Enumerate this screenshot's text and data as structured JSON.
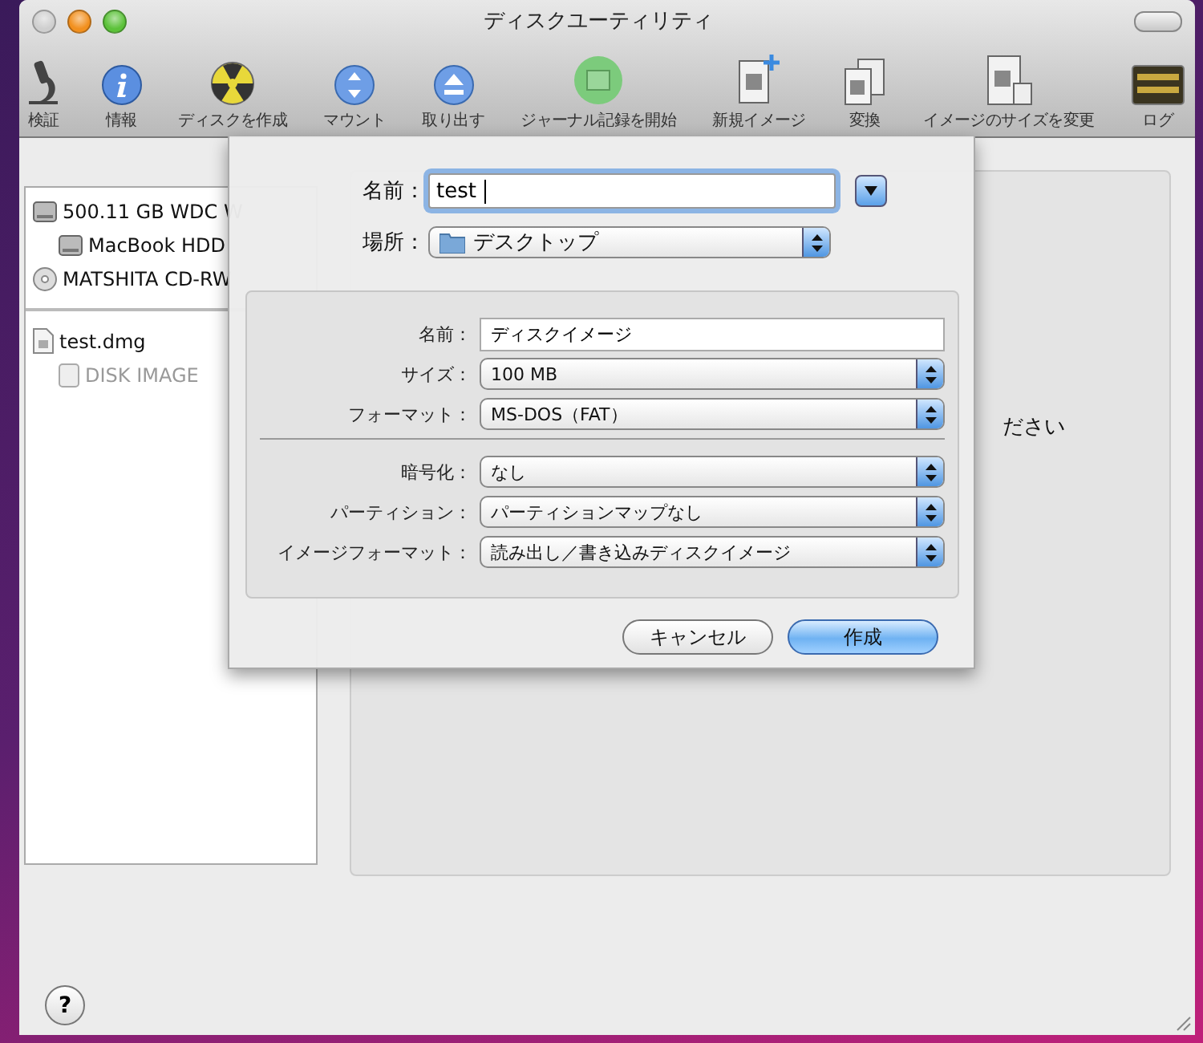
{
  "window": {
    "title": "ディスクユーティリティ"
  },
  "toolbar": [
    {
      "label": "検証"
    },
    {
      "label": "情報"
    },
    {
      "label": "ディスクを作成"
    },
    {
      "label": "マウント"
    },
    {
      "label": "取り出す"
    },
    {
      "label": "ジャーナル記録を開始"
    },
    {
      "label": "新規イメージ"
    },
    {
      "label": "変換"
    },
    {
      "label": "イメージのサイズを変更"
    },
    {
      "label": "ログ"
    }
  ],
  "sidebar": {
    "devices": [
      {
        "label": "500.11 GB WDC W",
        "kind": "hdd",
        "disabled": false,
        "children": [
          {
            "label": "MacBook HDD",
            "kind": "hdd",
            "disabled": false
          }
        ]
      },
      {
        "label": "MATSHITA CD-RW",
        "kind": "optical",
        "disabled": false
      }
    ],
    "images": [
      {
        "label": "test.dmg",
        "kind": "dmg",
        "disabled": false,
        "children": [
          {
            "label": "DISK IMAGE",
            "kind": "volume",
            "disabled": true
          }
        ]
      }
    ]
  },
  "main_panel": {
    "text": "ださい"
  },
  "sheet": {
    "name": {
      "label": "名前：",
      "value": "test",
      "focused": true
    },
    "location": {
      "label": "場所：",
      "value": "デスクトップ"
    },
    "group1": [
      {
        "label": "名前：",
        "value": "ディスクイメージ",
        "kind": "text"
      },
      {
        "label": "サイズ：",
        "value": "100 MB",
        "kind": "select"
      },
      {
        "label": "フォーマット：",
        "value": "MS-DOS（FAT）",
        "kind": "select"
      }
    ],
    "group2": [
      {
        "label": "暗号化：",
        "value": "なし",
        "kind": "select"
      },
      {
        "label": "パーティション：",
        "value": "パーティションマップなし",
        "kind": "select"
      },
      {
        "label": "イメージフォーマット：",
        "value": "読み出し／書き込みディスクイメージ",
        "kind": "select"
      }
    ],
    "buttons": [
      {
        "label": "キャンセル",
        "default": false
      },
      {
        "label": "作成",
        "default": true
      }
    ]
  },
  "help": {
    "label": "?"
  }
}
